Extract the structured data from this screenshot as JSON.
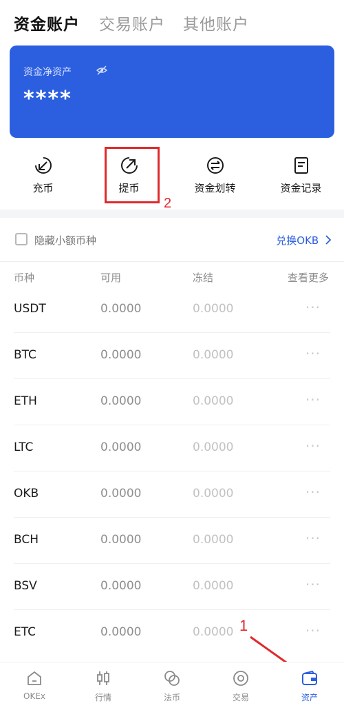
{
  "tabs": [
    {
      "label": "资金账户",
      "active": true
    },
    {
      "label": "交易账户",
      "active": false
    },
    {
      "label": "其他账户",
      "active": false
    }
  ],
  "card": {
    "label": "资金净资产",
    "value": "****",
    "icon": "eye-hidden-icon",
    "background": "#2c5fe0"
  },
  "actions": [
    {
      "label": "充币",
      "icon": "deposit-arrow-icon"
    },
    {
      "label": "提币",
      "icon": "withdraw-arrow-icon"
    },
    {
      "label": "资金划转",
      "icon": "transfer-icon"
    },
    {
      "label": "资金记录",
      "icon": "record-doc-icon"
    }
  ],
  "annotations": {
    "step1": "1",
    "step2": "2",
    "color": "#e0292c"
  },
  "filter": {
    "hide_small_label": "隐藏小额币种",
    "swap_label": "兑换OKB",
    "checked": false
  },
  "table": {
    "headers": [
      "币种",
      "可用",
      "冻结",
      "查看更多"
    ],
    "rows": [
      {
        "coin": "USDT",
        "available": "0.0000",
        "frozen": "0.0000",
        "more": "···"
      },
      {
        "coin": "BTC",
        "available": "0.0000",
        "frozen": "0.0000",
        "more": "···"
      },
      {
        "coin": "ETH",
        "available": "0.0000",
        "frozen": "0.0000",
        "more": "···"
      },
      {
        "coin": "LTC",
        "available": "0.0000",
        "frozen": "0.0000",
        "more": "···"
      },
      {
        "coin": "OKB",
        "available": "0.0000",
        "frozen": "0.0000",
        "more": "···"
      },
      {
        "coin": "BCH",
        "available": "0.0000",
        "frozen": "0.0000",
        "more": "···"
      },
      {
        "coin": "BSV",
        "available": "0.0000",
        "frozen": "0.0000",
        "more": "···"
      },
      {
        "coin": "ETC",
        "available": "0.0000",
        "frozen": "0.0000",
        "more": "···"
      }
    ]
  },
  "nav": [
    {
      "label": "OKEx",
      "icon": "home-icon",
      "active": false
    },
    {
      "label": "行情",
      "icon": "candlestick-icon",
      "active": false
    },
    {
      "label": "法币",
      "icon": "fiat-coins-icon",
      "active": false
    },
    {
      "label": "交易",
      "icon": "trade-icon",
      "active": false
    },
    {
      "label": "资产",
      "icon": "wallet-icon",
      "active": true
    }
  ],
  "colors": {
    "accent": "#2c5fe0",
    "annotation_red": "#e0292c"
  }
}
